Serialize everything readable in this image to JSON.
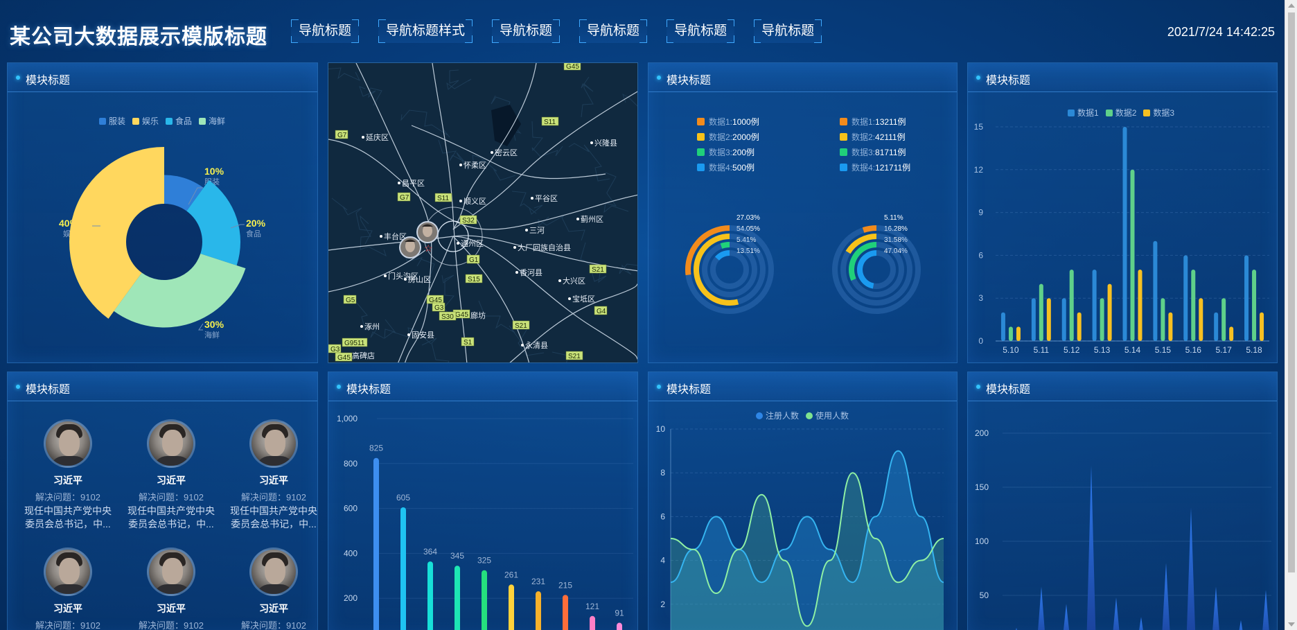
{
  "header": {
    "title": "某公司大数据展示模版标题",
    "nav": [
      "导航标题",
      "导航标题样式",
      "导航标题",
      "导航标题",
      "导航标题",
      "导航标题"
    ],
    "datetime": "2021/7/24 14:42:25"
  },
  "panels": {
    "donut": {
      "title": "模块标题",
      "legend": [
        {
          "name": "服装",
          "color": "#2f7fd8"
        },
        {
          "name": "娱乐",
          "color": "#ffd75e"
        },
        {
          "name": "食品",
          "color": "#29b7ea"
        },
        {
          "name": "海鲜",
          "color": "#9fe6b8"
        }
      ],
      "labels": [
        {
          "pct": "10%",
          "name": "服装"
        },
        {
          "pct": "20%",
          "name": "食品"
        },
        {
          "pct": "30%",
          "name": "海鲜"
        },
        {
          "pct": "40%",
          "name": "娱乐"
        }
      ]
    },
    "map": {
      "places": [
        "延庆区",
        "怀柔区",
        "密云区",
        "兴隆县",
        "昌平区",
        "顺义区",
        "平谷区",
        "蓟州区",
        "通州区",
        "三河",
        "大厂回族自治县",
        "丰台区",
        "香河县",
        "门头沟区",
        "房山区",
        "大兴区",
        "宝坻区",
        "廊坊",
        "涿州",
        "固安县",
        "永清县",
        "高碑店"
      ],
      "roads": [
        "G45",
        "G7",
        "S11",
        "G7",
        "S11",
        "S32",
        "G1",
        "S15",
        "G5",
        "G45",
        "G3",
        "G45",
        "S30",
        "S21",
        "S21",
        "G4",
        "G9511",
        "G3",
        "S1",
        "S21",
        "G45"
      ]
    },
    "rings": {
      "title": "模块标题",
      "left_list": [
        {
          "label": "数据1:",
          "value": "1000例",
          "color": "#f28b1c"
        },
        {
          "label": "数据2:",
          "value": "2000例",
          "color": "#f7c21a"
        },
        {
          "label": "数据3:",
          "value": "200例",
          "color": "#20d07a"
        },
        {
          "label": "数据4:",
          "value": "500例",
          "color": "#1a9af0"
        }
      ],
      "right_list": [
        {
          "label": "数据1:",
          "value": "13211例",
          "color": "#f28b1c"
        },
        {
          "label": "数据2:",
          "value": "42111例",
          "color": "#f7c21a"
        },
        {
          "label": "数据3:",
          "value": "81711例",
          "color": "#20d07a"
        },
        {
          "label": "数据4:",
          "value": "121711例",
          "color": "#1a9af0"
        }
      ],
      "left_pcts": [
        "27.03%",
        "54.05%",
        "5.41%",
        "13.51%"
      ],
      "right_pcts": [
        "5.11%",
        "16.28%",
        "31.58%",
        "47.04%"
      ]
    },
    "bars3": {
      "title": "模块标题",
      "legend": [
        {
          "name": "数据1",
          "color": "#2b89d6"
        },
        {
          "name": "数据2",
          "color": "#5fd08a"
        },
        {
          "name": "数据3",
          "color": "#f6c022"
        }
      ]
    },
    "people": {
      "title": "模块标题",
      "items": [
        {
          "name": "习近平",
          "stat": "解决问题：9102",
          "desc1": "现任中国共产党中央",
          "desc2": "委员会总书记，中..."
        },
        {
          "name": "习近平",
          "stat": "解决问题：9102",
          "desc1": "现任中国共产党中央",
          "desc2": "委员会总书记，中..."
        },
        {
          "name": "习近平",
          "stat": "解决问题：9102",
          "desc1": "现任中国共产党中央",
          "desc2": "委员会总书记，中..."
        },
        {
          "name": "习近平",
          "stat": "解决问题：9102",
          "desc1": "",
          "desc2": ""
        },
        {
          "name": "习近平",
          "stat": "解决问题：9102",
          "desc1": "",
          "desc2": ""
        },
        {
          "name": "习近平",
          "stat": "解决问题：9102",
          "desc1": "",
          "desc2": ""
        }
      ]
    },
    "bars_single": {
      "title": "模块标题"
    },
    "lines": {
      "title": "模块标题",
      "legend": [
        {
          "name": "注册人数",
          "color": "#2f86e6"
        },
        {
          "name": "使用人数",
          "color": "#7fe38f"
        }
      ]
    },
    "spikes": {
      "title": "模块标题"
    }
  },
  "chart_data": [
    {
      "type": "pie",
      "categories": [
        "服装",
        "食品",
        "海鲜",
        "娱乐"
      ],
      "values": [
        10,
        20,
        30,
        40
      ],
      "colors": [
        "#2f7fd8",
        "#29b7ea",
        "#9fe6b8",
        "#ffd75e"
      ]
    },
    {
      "type": "bar",
      "categories": [
        "5.10",
        "5.11",
        "5.12",
        "5.13",
        "5.14",
        "5.15",
        "5.16",
        "5.17",
        "5.18"
      ],
      "series": [
        {
          "name": "数据1",
          "values": [
            2,
            3,
            3,
            5,
            15,
            7,
            6,
            2,
            6
          ],
          "color": "#2b89d6"
        },
        {
          "name": "数据2",
          "values": [
            1,
            4,
            5,
            3,
            12,
            3,
            5,
            3,
            5
          ],
          "color": "#5fd08a"
        },
        {
          "name": "数据3",
          "values": [
            1,
            3,
            2,
            4,
            5,
            2,
            3,
            1,
            2
          ],
          "color": "#f6c022"
        }
      ],
      "ylim": [
        0,
        15
      ],
      "yticks": [
        0,
        3,
        6,
        9,
        12,
        15
      ]
    },
    {
      "type": "bar",
      "values": [
        825,
        605,
        364,
        345,
        325,
        261,
        231,
        215,
        121,
        91
      ],
      "colors": [
        "#3d8ef0",
        "#1fc3f2",
        "#17e0d8",
        "#1ee6b4",
        "#25e07e",
        "#ffd23b",
        "#f7b12b",
        "#ff6e3a",
        "#ff7fc6",
        "#ff8ad8"
      ],
      "ylim": [
        0,
        1000
      ],
      "yticks": [
        "200",
        "400",
        "600",
        "800",
        "1,000"
      ]
    },
    {
      "type": "area",
      "x": [
        0,
        1,
        2,
        3,
        4,
        5,
        6,
        7,
        8,
        9,
        10,
        11,
        12
      ],
      "series": [
        {
          "name": "注册人数",
          "values": [
            3,
            4.5,
            6,
            4.5,
            3,
            4.5,
            6,
            4.5,
            3,
            6,
            9,
            6,
            3
          ],
          "color": "#35b4f0"
        },
        {
          "name": "使用人数",
          "values": [
            5,
            4.5,
            2.5,
            4.5,
            7,
            4,
            1,
            4,
            8,
            5,
            3,
            4,
            5
          ],
          "color": "#8ff0a4"
        }
      ],
      "ylim": [
        0,
        10
      ],
      "yticks": [
        2,
        4,
        6,
        8,
        10
      ]
    },
    {
      "type": "area",
      "values": [
        20,
        58,
        42,
        170,
        48,
        30,
        80,
        131,
        58,
        27,
        55
      ],
      "ylim": [
        0,
        200
      ],
      "yticks": [
        50,
        100,
        150,
        200
      ]
    }
  ]
}
